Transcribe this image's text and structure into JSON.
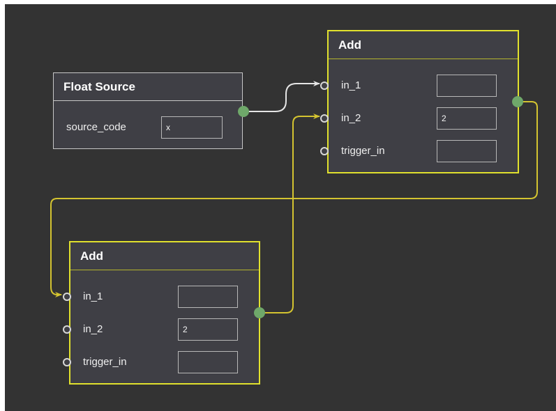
{
  "colors": {
    "canvas": "#333333",
    "node_bg": "#3f3f45",
    "selected_border": "#e1e12d",
    "wire_selected": "#d4c430",
    "wire_default": "#e6e6e6",
    "output_port": "#6fa86a"
  },
  "nodes": {
    "float_source": {
      "title": "Float Source",
      "param_label": "source_code",
      "param_value": "x"
    },
    "add_top": {
      "title": "Add",
      "inputs": [
        {
          "label": "in_1",
          "value": ""
        },
        {
          "label": "in_2",
          "value": "2"
        },
        {
          "label": "trigger_in",
          "value": ""
        }
      ]
    },
    "add_bottom": {
      "title": "Add",
      "inputs": [
        {
          "label": "in_1",
          "value": ""
        },
        {
          "label": "in_2",
          "value": "2"
        },
        {
          "label": "trigger_in",
          "value": ""
        }
      ]
    }
  }
}
